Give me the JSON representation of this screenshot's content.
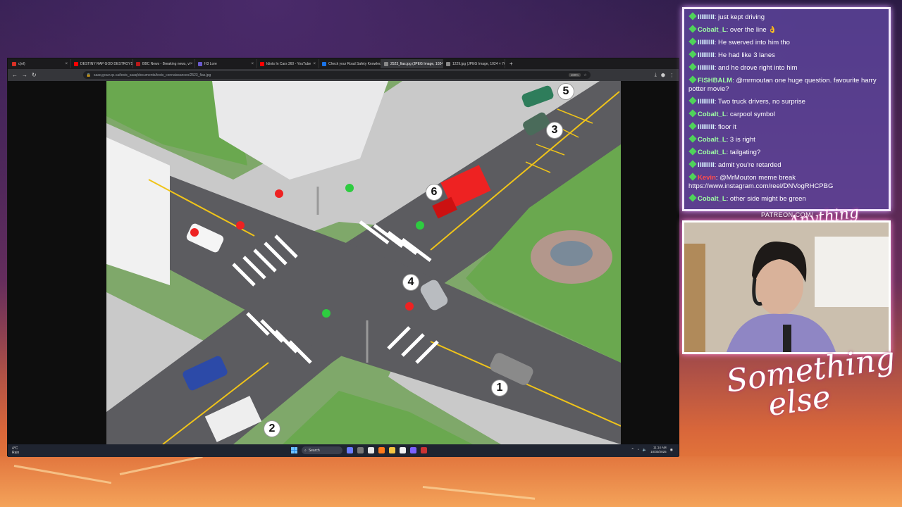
{
  "browser": {
    "tabs": [
      {
        "label": "c(el)",
        "color": "#d93025"
      },
      {
        "label": "DESTINY RAP GOD DESTROYS",
        "color": "#ff0000"
      },
      {
        "label": "BBC News - Breaking news, vi",
        "color": "#bb1919"
      },
      {
        "label": "H3 Lore",
        "color": "#6a5acd"
      },
      {
        "label": "Idiots In Cars 360 - YouTube",
        "color": "#ff0000"
      },
      {
        "label": "Check your Road Safety Knowledge",
        "color": "#1a73e8"
      },
      {
        "label": "2523_fias.jpg (JPEG Image, 1024 ×",
        "color": "#888888"
      },
      {
        "label": "1229.jpg (JPEG Image, 1024 × 768",
        "color": "#888888"
      }
    ],
    "url": "saaq.gouv.qc.ca/tests_saaq/documents/tests_connaissances/2523_fias.jpg",
    "zoom": "180%"
  },
  "scene": {
    "markers": [
      "1",
      "2",
      "3",
      "4",
      "5",
      "6"
    ]
  },
  "taskbar": {
    "temp": "4°C",
    "weather": "Rain",
    "search_placeholder": "Search",
    "time": "11:14 AM",
    "date": "10/30/2025"
  },
  "chat": {
    "messages": [
      {
        "user": "IIIIIIIII",
        "text": "just kept driving",
        "kind": "plain"
      },
      {
        "user": "Cobalt_L",
        "text": "over the line 👌",
        "kind": "cobalt"
      },
      {
        "user": "IIIIIIIII",
        "text": "He swerved into him tho",
        "kind": "plain"
      },
      {
        "user": "IIIIIIIII",
        "text": "He had like 3 lanes",
        "kind": "plain"
      },
      {
        "user": "IIIIIIIII",
        "text": "and he drove right into him",
        "kind": "plain"
      },
      {
        "user": "FISHBALM",
        "text": "@mrmoutan one huge question. favourite harry potter movie?",
        "kind": "fish"
      },
      {
        "user": "IIIIIIIII",
        "text": "Two truck drivers, no surprise",
        "kind": "plain"
      },
      {
        "user": "Cobalt_L",
        "text": "carpool symbol",
        "kind": "cobalt"
      },
      {
        "user": "IIIIIIIII",
        "text": "floor it",
        "kind": "plain"
      },
      {
        "user": "Cobalt_L",
        "text": "3 is right",
        "kind": "cobalt"
      },
      {
        "user": "Cobalt_L",
        "text": "tailgating?",
        "kind": "cobalt"
      },
      {
        "user": "IIIIIIIII",
        "text": "admit you're retarded",
        "kind": "plain"
      },
      {
        "user": "Kevin",
        "text": "@MrMouton meme break https://www.instagram.com/reel/DNVogRHCPBG",
        "kind": "red"
      },
      {
        "user": "Cobalt_L",
        "text": "other side might be green",
        "kind": "cobalt"
      }
    ]
  },
  "overlay": {
    "patreon": "PATREON.COM/",
    "logo_small": "Anything else?",
    "logo_big_line1": "Something",
    "logo_big_line2": "else"
  },
  "colors": {
    "accent_chat": "#5f46a0",
    "badge": "#4fd35a",
    "road": "#5c5c60",
    "grass": "#6aa84f"
  }
}
